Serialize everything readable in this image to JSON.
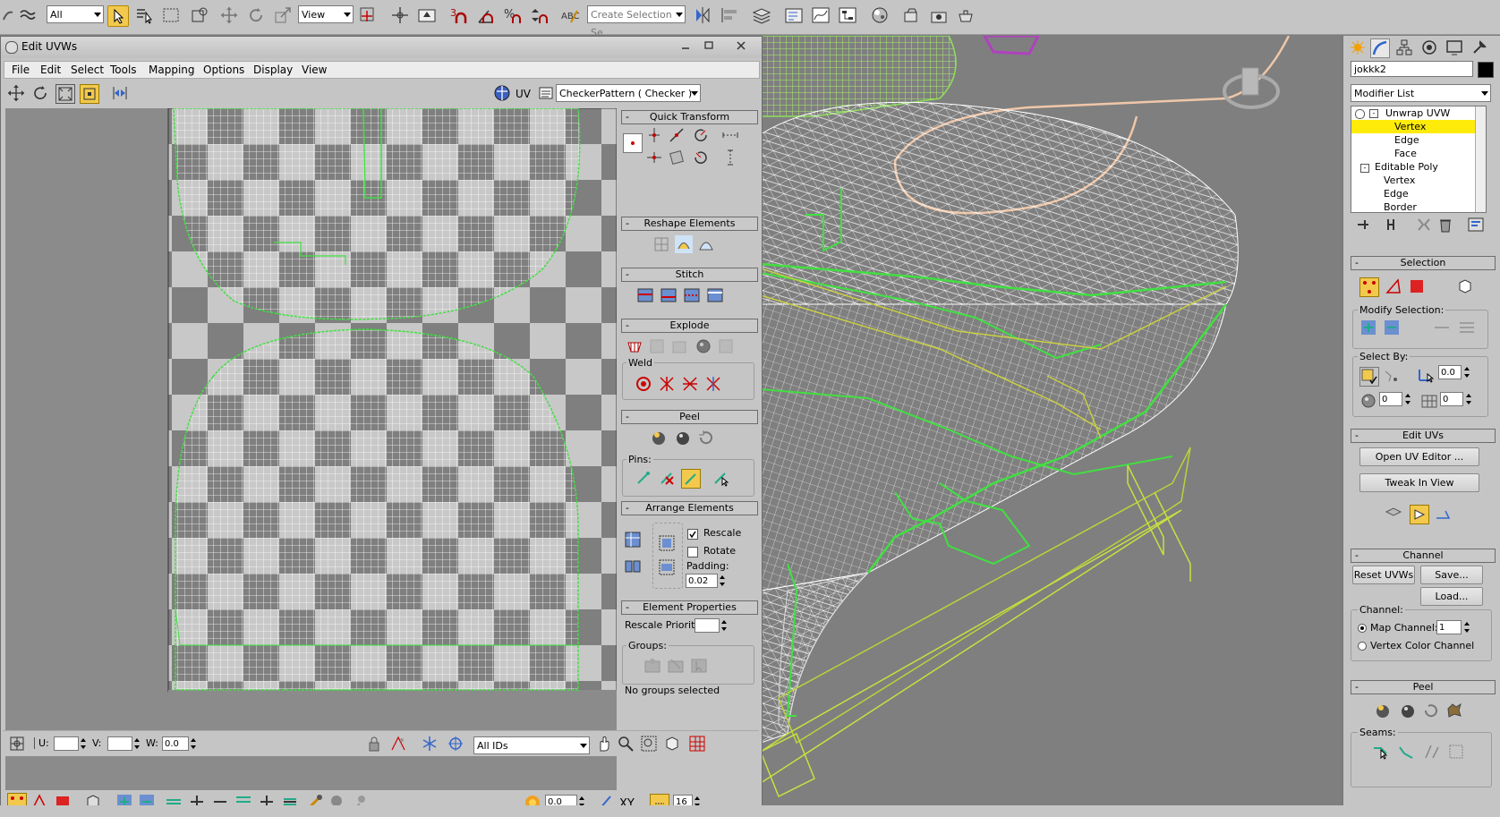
{
  "toolbar": {
    "selection_filter": "All",
    "reference_coord": "View",
    "snap_count": "3",
    "named_selection_placeholder": "Create Selection Se",
    "colors": {
      "highlight": "#f2c94c",
      "active_icon": "#ffd700"
    }
  },
  "uv_window": {
    "title": "Edit UVWs",
    "menu": [
      "File",
      "Edit",
      "Select",
      "Tools",
      "Mapping",
      "Options",
      "Display",
      "View"
    ],
    "uv_label": "UV",
    "texture_dropdown": "CheckerPattern  ( Checker )",
    "rollouts": {
      "quick_transform": "Quick Transform",
      "reshape_elements": "Reshape Elements",
      "stitch": "Stitch",
      "explode": "Explode",
      "weld": "Weld",
      "peel": "Peel",
      "pins": "Pins:",
      "arrange_elements": "Arrange Elements",
      "rescale": "Rescale",
      "rotate": "Rotate",
      "padding_label": "Padding:",
      "padding_value": "0.02",
      "element_properties": "Element Properties",
      "rescale_priority": "Rescale Priority:",
      "groups": "Groups:",
      "groups_status": "No groups selected"
    },
    "bottom_bar": {
      "spinner_value": "0.0",
      "xy_label": "XY",
      "pixel_value": "16",
      "u_label": "U:",
      "v_label": "V:",
      "w_label": "W:",
      "w_value": "0.0",
      "ids_dropdown": "All IDs"
    }
  },
  "command_panel": {
    "object_name": "jokkk2",
    "modifier_list": "Modifier List",
    "stack": [
      {
        "label": "Unwrap UVW",
        "level": 0,
        "selected": false
      },
      {
        "label": "Vertex",
        "level": 1,
        "selected": true
      },
      {
        "label": "Edge",
        "level": 1,
        "selected": false
      },
      {
        "label": "Face",
        "level": 1,
        "selected": false
      },
      {
        "label": "Editable Poly",
        "level": 0,
        "selected": false
      },
      {
        "label": "Vertex",
        "level": 1,
        "selected": false
      },
      {
        "label": "Edge",
        "level": 1,
        "selected": false
      },
      {
        "label": "Border",
        "level": 1,
        "selected": false
      }
    ],
    "selection": {
      "title": "Selection",
      "modify_selection": "Modify Selection:",
      "select_by": "Select By:",
      "angle_value": "0.0",
      "spin_a": "0",
      "spin_b": "0"
    },
    "edit_uvs": {
      "title": "Edit UVs",
      "open_uv_editor": "Open UV Editor ...",
      "tweak_in_view": "Tweak In View"
    },
    "channel": {
      "title": "Channel",
      "reset_uvws": "Reset UVWs",
      "save": "Save...",
      "load": "Load...",
      "channel_label": "Channel:",
      "map_channel": "Map Channel:",
      "map_channel_value": "1",
      "vertex_color_channel": "Vertex Color Channel"
    },
    "peel": {
      "title": "Peel",
      "seams": "Seams:"
    }
  }
}
